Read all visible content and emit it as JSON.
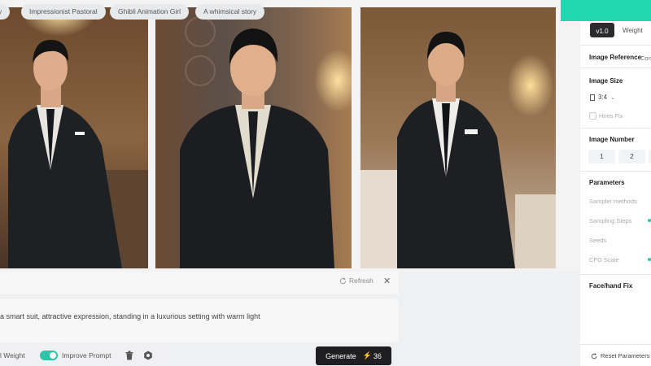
{
  "chips": {
    "items": [
      {
        "label": "y"
      },
      {
        "label": "Impressionist Pastoral"
      },
      {
        "label": "Ghibli Animation Girl"
      },
      {
        "label": "A whimsical story"
      }
    ],
    "refresh_label": "Refresh",
    "close_symbol": "✕"
  },
  "prompt": {
    "text": "a smart suit, attractive expression, standing in a luxurious setting with warm light"
  },
  "toolbar": {
    "weight_label": "l Weight",
    "improve_prompt_label": "Improve Prompt",
    "improve_prompt_enabled": true,
    "generate_label": "Generate",
    "generate_cost": "36"
  },
  "panel": {
    "version": "v1.0",
    "weight_label": "Weight",
    "image_reference": "Image Reference",
    "image_reference_tab2": "Con",
    "image_size": "Image Size",
    "ratio": "3:4",
    "hires_fix": "Hires Fix",
    "image_number": "Image Number",
    "numbers": [
      "1",
      "2"
    ],
    "parameters": "Parameters",
    "sampler_methods": "Sampler methods",
    "sampling_steps": "Sampling Steps",
    "seeds": "Seeds",
    "cfg_scale": "CFG Scale",
    "face_hand_fix": "Face/hand Fix",
    "reset_label": "Reset Parameters"
  },
  "colors": {
    "accent": "#23d7b2",
    "generate_bg": "#1f1f21",
    "bolt": "#f3c12b"
  }
}
